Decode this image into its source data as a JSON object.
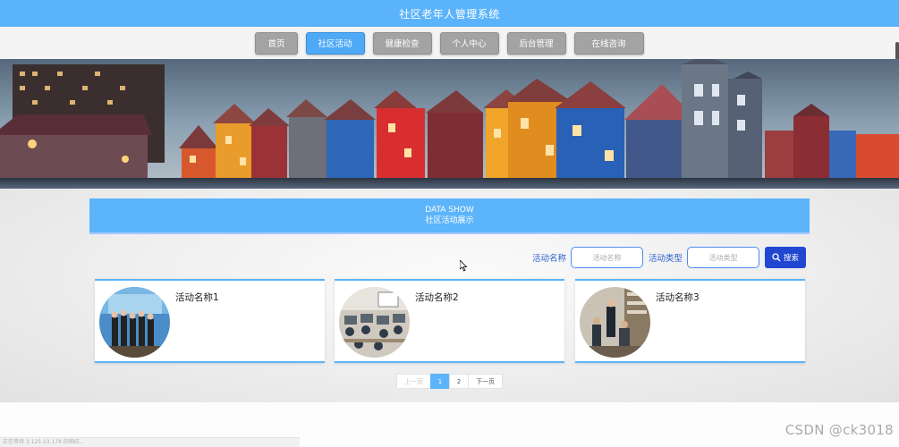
{
  "header": {
    "title": "社区老年人管理系统"
  },
  "nav": {
    "items": [
      {
        "label": "首页",
        "active": false
      },
      {
        "label": "社区活动",
        "active": true
      },
      {
        "label": "健康检查",
        "active": false
      },
      {
        "label": "个人中心",
        "active": false
      },
      {
        "label": "后台管理",
        "active": false
      },
      {
        "label": "在线咨询",
        "active": false
      }
    ]
  },
  "section": {
    "title_en": "DATA SHOW",
    "title_cn": "社区活动展示"
  },
  "search": {
    "name_label": "活动名称",
    "name_placeholder": "活动名称",
    "type_label": "活动类型",
    "type_placeholder": "活动类型",
    "button_label": "搜索",
    "button_icon": "search-icon"
  },
  "cards": [
    {
      "title": "活动名称1"
    },
    {
      "title": "活动名称2"
    },
    {
      "title": "活动名称3"
    }
  ],
  "pager": {
    "prev": "上一页",
    "pages": [
      "1",
      "2"
    ],
    "current": "1",
    "next": "下一页"
  },
  "status_text": "正在等待 3.125.13.174 的响应…",
  "watermark": "CSDN @ck3018",
  "colors": {
    "accent": "#5cb4fa",
    "search_button": "#2147d1",
    "nav_inactive": "#a3a3a3"
  }
}
